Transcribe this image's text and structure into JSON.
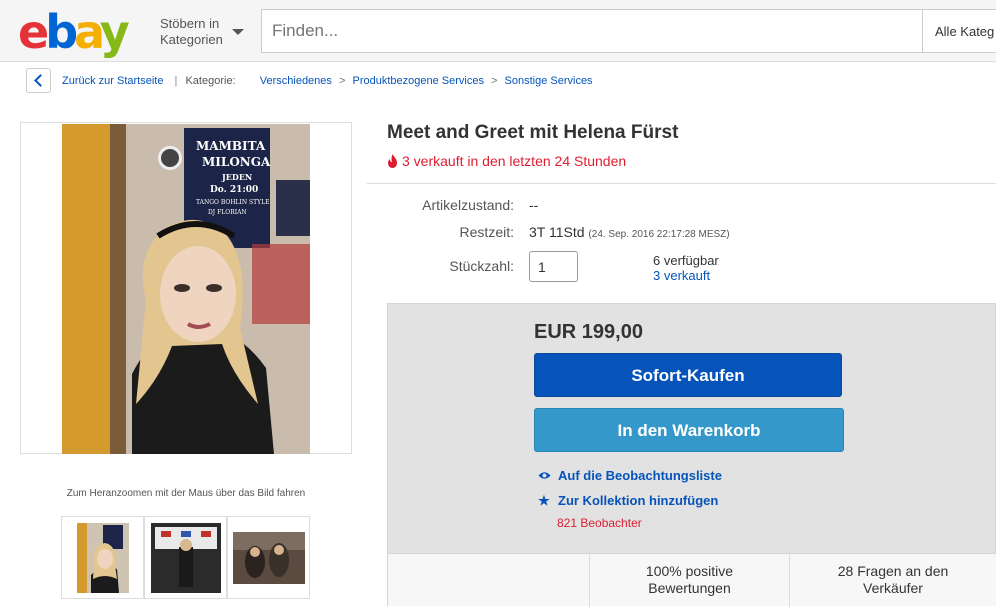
{
  "header": {
    "logo": {
      "e": "e",
      "b": "b",
      "a": "a",
      "y": "y"
    },
    "browse_line1": "Stöbern in",
    "browse_line2": "Kategorien",
    "search_placeholder": "Finden...",
    "category_select": "Alle Kateg"
  },
  "breadcrumb": {
    "back_label": "Zurück zur Startseite",
    "category_label": "Kategorie:",
    "items": [
      "Verschiedenes",
      "Produktbezogene Services",
      "Sonstige Services"
    ],
    "separator": ">"
  },
  "gallery": {
    "zoom_hint": "Zum Heranzoomen mit der Maus über das Bild fahren",
    "poster_line1": "MAMBITA",
    "poster_line2": "MILONGA",
    "poster_line3": "JEDEN",
    "poster_line4": "Do. 21:00",
    "poster_line5": "TANGO BOHLIN STYLE",
    "poster_line6": "DJ FLORIAN"
  },
  "item": {
    "title": "Meet and Greet mit Helena Fürst",
    "sold_recent": "3 verkauft in den letzten 24 Stunden",
    "condition_label": "Artikelzustand:",
    "condition_value": "--",
    "time_label": "Restzeit:",
    "time_value": "3T 11Std",
    "time_detail": "(24. Sep. 2016   22:17:28 MESZ)",
    "qty_label": "Stückzahl:",
    "qty_value": "1",
    "available": "6 verfügbar",
    "sold": "3 verkauft"
  },
  "buybox": {
    "price": "EUR 199,00",
    "buy_now": "Sofort-Kaufen",
    "add_to_cart": "In den Warenkorb",
    "watchlist": "Auf die Beobachtungsliste",
    "collection": "Zur Kollektion hinzufügen",
    "watchers": "821 Beobachter",
    "feedback_line1": "100% positive",
    "feedback_line2": "Bewertungen",
    "questions_line1": "28 Fragen an den",
    "questions_line2": "Verkäufer"
  },
  "colors": {
    "link": "#0654ba",
    "buy_button": "#0654ba",
    "cart_button": "#3498ca",
    "alert_red": "#dd1e31"
  }
}
